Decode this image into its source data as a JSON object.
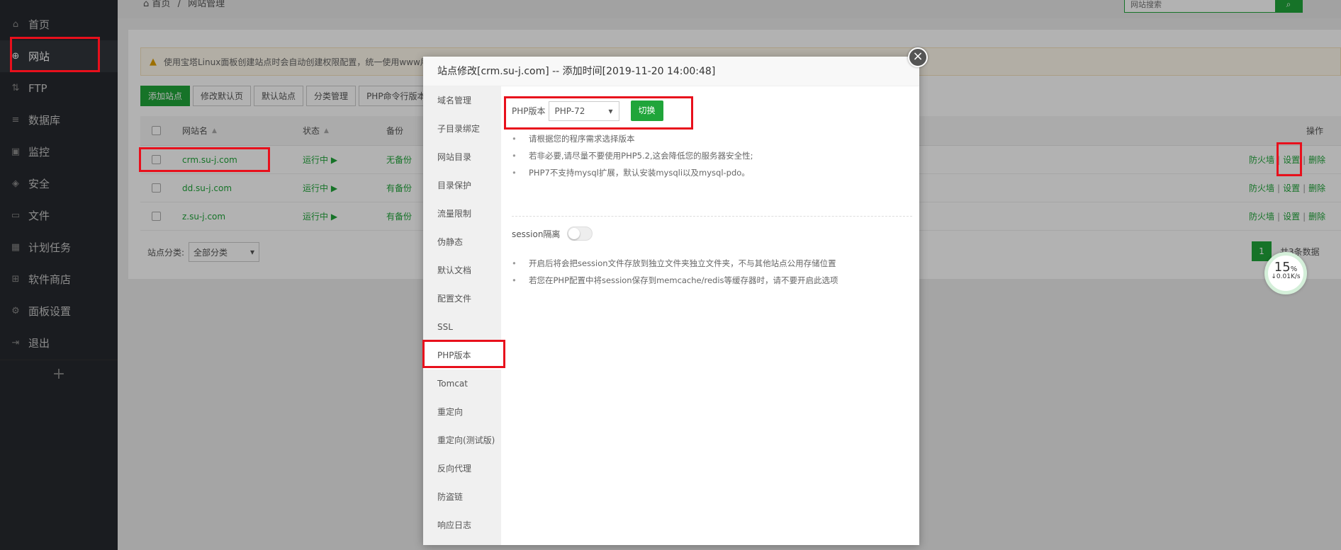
{
  "breadcrumb": {
    "home": "首页",
    "sep": "/",
    "current": "网站管理"
  },
  "search": {
    "placeholder": "网站搜索"
  },
  "sidebar": {
    "items": [
      {
        "label": "首页",
        "icon": "home-icon"
      },
      {
        "label": "网站",
        "icon": "globe-icon",
        "active": true
      },
      {
        "label": "FTP",
        "icon": "ftp-icon"
      },
      {
        "label": "数据库",
        "icon": "database-icon"
      },
      {
        "label": "监控",
        "icon": "monitor-icon"
      },
      {
        "label": "安全",
        "icon": "shield-icon"
      },
      {
        "label": "文件",
        "icon": "folder-icon"
      },
      {
        "label": "计划任务",
        "icon": "calendar-icon"
      },
      {
        "label": "软件商店",
        "icon": "grid-icon"
      },
      {
        "label": "面板设置",
        "icon": "gear-icon"
      },
      {
        "label": "退出",
        "icon": "logout-icon"
      }
    ],
    "add": "+"
  },
  "notice": {
    "text": "使用宝塔Linux面板创建站点时会自动创建权限配置，统一使用www用户"
  },
  "toolbar": {
    "buttons": [
      "添加站点",
      "修改默认页",
      "默认站点",
      "分类管理",
      "PHP命令行版本"
    ]
  },
  "table": {
    "headers": {
      "name": "网站名",
      "status": "状态",
      "backup": "备份",
      "ops": "操作"
    },
    "rows": [
      {
        "name": "crm.su-j.com",
        "status": "运行中 ▶",
        "backup": "无备份",
        "firewall": "防火墙",
        "settings": "设置",
        "delete": "删除"
      },
      {
        "name": "dd.su-j.com",
        "status": "运行中 ▶",
        "backup": "有备份",
        "firewall": "防火墙",
        "settings": "设置",
        "delete": "删除"
      },
      {
        "name": "z.su-j.com",
        "status": "运行中 ▶",
        "backup": "有备份",
        "firewall": "防火墙",
        "settings": "设置",
        "delete": "删除"
      }
    ],
    "sep": "|"
  },
  "category": {
    "label": "站点分类:",
    "value": "全部分类"
  },
  "pagination": {
    "current": "1",
    "total": "共3条数据"
  },
  "gauge": {
    "percent": "15",
    "unit": "%",
    "speed": "↓0.01K/s"
  },
  "modal": {
    "title": "站点修改[crm.su-j.com] -- 添加时间[2019-11-20 14:00:48]",
    "close": "×",
    "nav": [
      "域名管理",
      "子目录绑定",
      "网站目录",
      "目录保护",
      "流量限制",
      "伪静态",
      "默认文档",
      "配置文件",
      "SSL",
      "PHP版本",
      "Tomcat",
      "重定向",
      "重定向(测试版)",
      "反向代理",
      "防盗链",
      "响应日志"
    ],
    "php": {
      "label": "PHP版本",
      "value": "PHP-72",
      "switch": "切换",
      "tips": [
        "请根据您的程序需求选择版本",
        "若非必要,请尽量不要使用PHP5.2,这会降低您的服务器安全性;",
        "PHP7不支持mysql扩展，默认安装mysqli以及mysql-pdo。"
      ]
    },
    "session": {
      "label": "session隔离",
      "enabled": false,
      "tips": [
        "开启后将会把session文件存放到独立文件夹独立文件夹，不与其他站点公用存储位置",
        "若您在PHP配置中将session保存到memcache/redis等缓存器时，请不要开启此选项"
      ]
    }
  },
  "colors": {
    "accent": "#20a53a",
    "highlight": "#e8101c",
    "sidebar": "#26292e"
  }
}
